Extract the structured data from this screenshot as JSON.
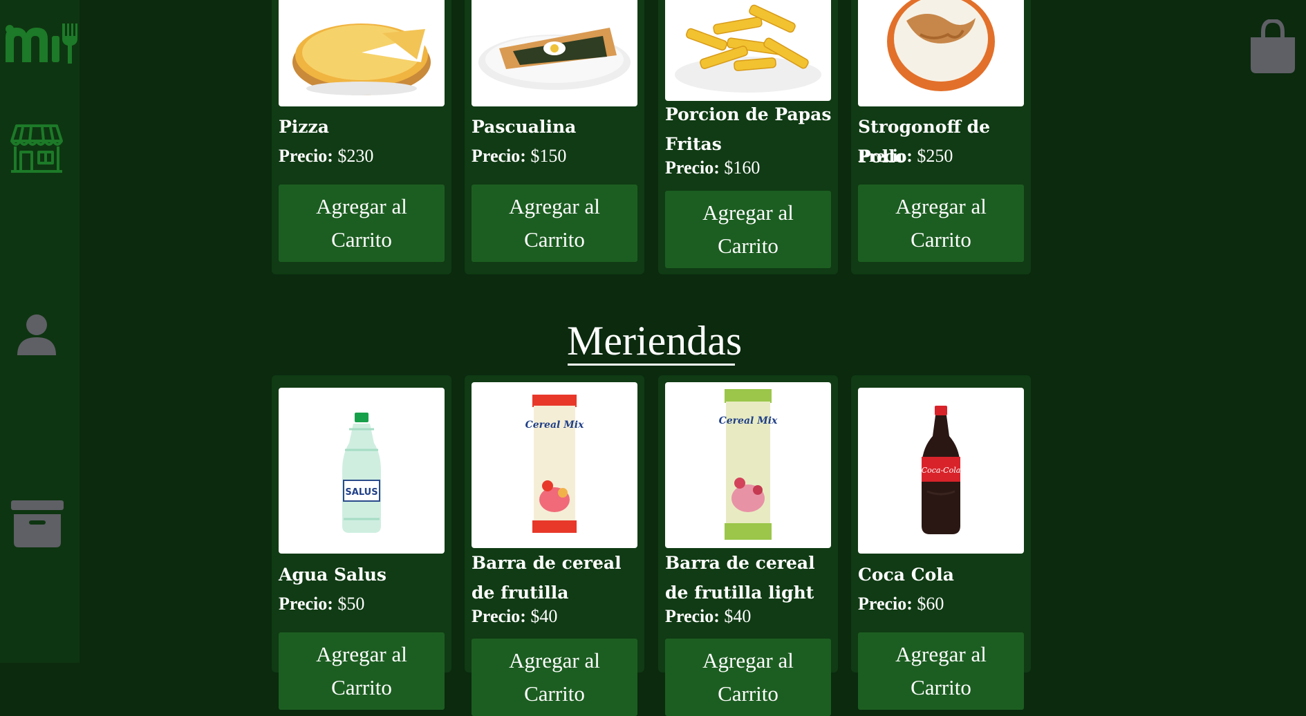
{
  "colors": {
    "background": "#0b2a0e",
    "sidebar": "#0e3511",
    "card": "#103b14",
    "button": "#1c5e21",
    "icon_green": "#1c7a28",
    "icon_gray": "#5f5f66"
  },
  "sidebar": {
    "logo_icon": "menu-logo-m-fork-icon",
    "items": [
      {
        "icon": "store-icon"
      },
      {
        "icon": "user-icon"
      },
      {
        "icon": "archive-box-icon"
      }
    ]
  },
  "cart": {
    "icon": "shopping-bag-icon"
  },
  "price_prefix": "Precio:",
  "add_button_label": "Agregar al Carrito",
  "top_products": [
    {
      "name": "Pizza",
      "price": "$230",
      "image": "pizza"
    },
    {
      "name": "Pascualina",
      "price": "$150",
      "image": "pascualina"
    },
    {
      "name": "Porcion de Papas Fritas",
      "price": "$160",
      "image": "fries"
    },
    {
      "name": "Strogonoff de Pollo",
      "price": "$250",
      "image": "strogonoff"
    }
  ],
  "section": {
    "title": "Meriendas"
  },
  "meriendas": [
    {
      "name": "Agua Salus",
      "price": "$50",
      "image": "water-bottle",
      "image_text": "SALUS"
    },
    {
      "name": "Barra de cereal de frutilla",
      "price": "$40",
      "image": "cereal-bar",
      "image_text": "Cereal Mix"
    },
    {
      "name": "Barra de cereal de frutilla light",
      "price": "$40",
      "image": "cereal-bar-light",
      "image_text": "Cereal Mix"
    },
    {
      "name": "Coca Cola",
      "price": "$60",
      "image": "cola-bottle",
      "image_text": "Coca-Cola"
    }
  ]
}
